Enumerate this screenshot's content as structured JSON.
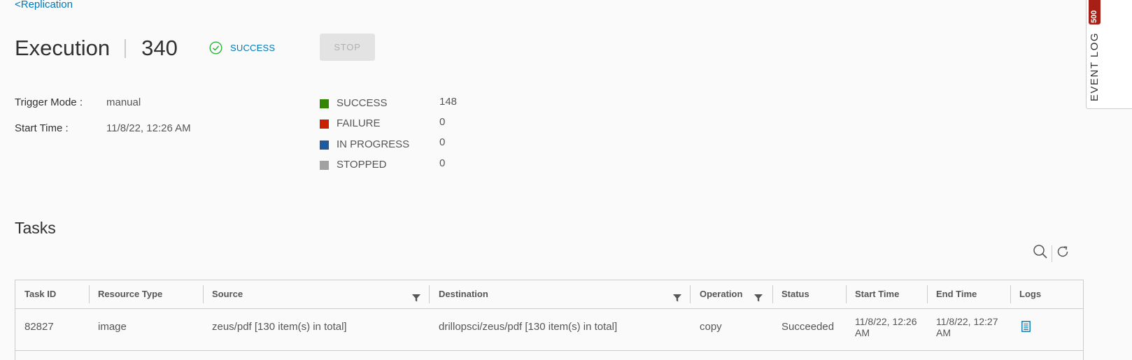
{
  "nav": {
    "back_label": "<Replication"
  },
  "header": {
    "title": "Execution",
    "execution_id": "340",
    "status": "SUCCESS",
    "stop_label": "STOP"
  },
  "info": {
    "trigger_mode_label": "Trigger Mode :",
    "trigger_mode_value": "manual",
    "start_time_label": "Start Time :",
    "start_time_value": "11/8/22, 12:26 AM"
  },
  "stats": [
    {
      "label": "SUCCESS",
      "value": "148",
      "color": "#318700"
    },
    {
      "label": "FAILURE",
      "value": "0",
      "color": "#c92100"
    },
    {
      "label": "IN PROGRESS",
      "value": "0",
      "color": "#1d5b9e"
    },
    {
      "label": "STOPPED",
      "value": "0",
      "color": "#a1a1a1"
    }
  ],
  "tasks": {
    "title": "Tasks",
    "icons": [
      "search-icon",
      "refresh-icon"
    ],
    "columns": [
      "Task ID",
      "Resource Type",
      "Source",
      "Destination",
      "Operation",
      "Status",
      "Start Time",
      "End Time",
      "Logs"
    ],
    "rows": [
      {
        "task_id": "82827",
        "resource_type": "image",
        "source": "zeus/pdf [130 item(s) in total]",
        "destination": "drillopsci/zeus/pdf [130 item(s) in total]",
        "operation": "copy",
        "status": "Succeeded",
        "start_time_1": "11/8/22, 12:26",
        "start_time_2": "AM",
        "end_time_1": "11/8/22, 12:27",
        "end_time_2": "AM",
        "logs_icon": "document-icon"
      }
    ]
  },
  "side_panel": {
    "label": "EVENT LOG",
    "badge": "500"
  }
}
